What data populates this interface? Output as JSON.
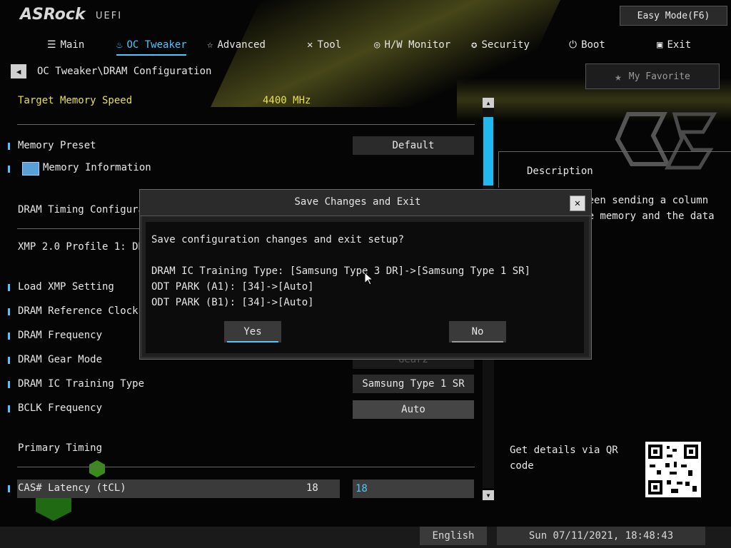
{
  "brand": {
    "name": "ASRock",
    "sub": "UEFI"
  },
  "easy_mode": "Easy Mode(F6)",
  "nav": [
    {
      "label": "Main",
      "icon": "list-icon"
    },
    {
      "label": "OC Tweaker",
      "icon": "flame-icon"
    },
    {
      "label": "Advanced",
      "icon": "star-icon"
    },
    {
      "label": "Tool",
      "icon": "tools-icon"
    },
    {
      "label": "H/W Monitor",
      "icon": "monitor-icon"
    },
    {
      "label": "Security",
      "icon": "shield-icon"
    },
    {
      "label": "Boot",
      "icon": "power-icon"
    },
    {
      "label": "Exit",
      "icon": "exit-icon"
    }
  ],
  "breadcrumb": "OC Tweaker\\DRAM Configuration",
  "my_favorite": "My Favorite",
  "settings": {
    "target_speed_label": "Target Memory Speed",
    "target_speed_value": "4400 MHz",
    "memory_preset_label": "Memory Preset",
    "memory_preset_value": "Default",
    "memory_info_label": "Memory Information",
    "dram_timing_label": "DRAM Timing Configura",
    "xmp_label": "XMP 2.0 Profile 1: DD",
    "load_xmp_label": "Load XMP Setting",
    "ref_clock_label": "DRAM Reference Clock",
    "dram_freq_label": "DRAM Frequency",
    "gear_mode_label": "DRAM Gear Mode",
    "gear_mode_value": "Gear2",
    "ic_training_label": "DRAM IC Training Type",
    "ic_training_value": "Samsung Type 1 SR",
    "bclk_label": "BCLK Frequency",
    "bclk_value": "Auto",
    "primary_timing_label": "Primary Timing",
    "cas_label": "CAS# Latency (tCL)",
    "cas_current": "18",
    "cas_input": "18"
  },
  "description": {
    "title": "Description",
    "text": "The time between sending a column address to the memory and the data in response."
  },
  "qr_label": "Get details via QR code",
  "language": "English",
  "datetime": "Sun 07/11/2021, 18:48:43",
  "dialog": {
    "title": "Save Changes and Exit",
    "question": "Save configuration changes and exit setup?",
    "changes": [
      "DRAM IC Training Type: [Samsung Type 3 DR]->[Samsung Type 1 SR]",
      "ODT PARK (A1): [34]->[Auto]",
      "ODT PARK (B1): [34]->[Auto]"
    ],
    "yes": "Yes",
    "no": "No"
  },
  "colors": {
    "accent": "#4ac8ff",
    "highlight": "#e8e04a"
  }
}
